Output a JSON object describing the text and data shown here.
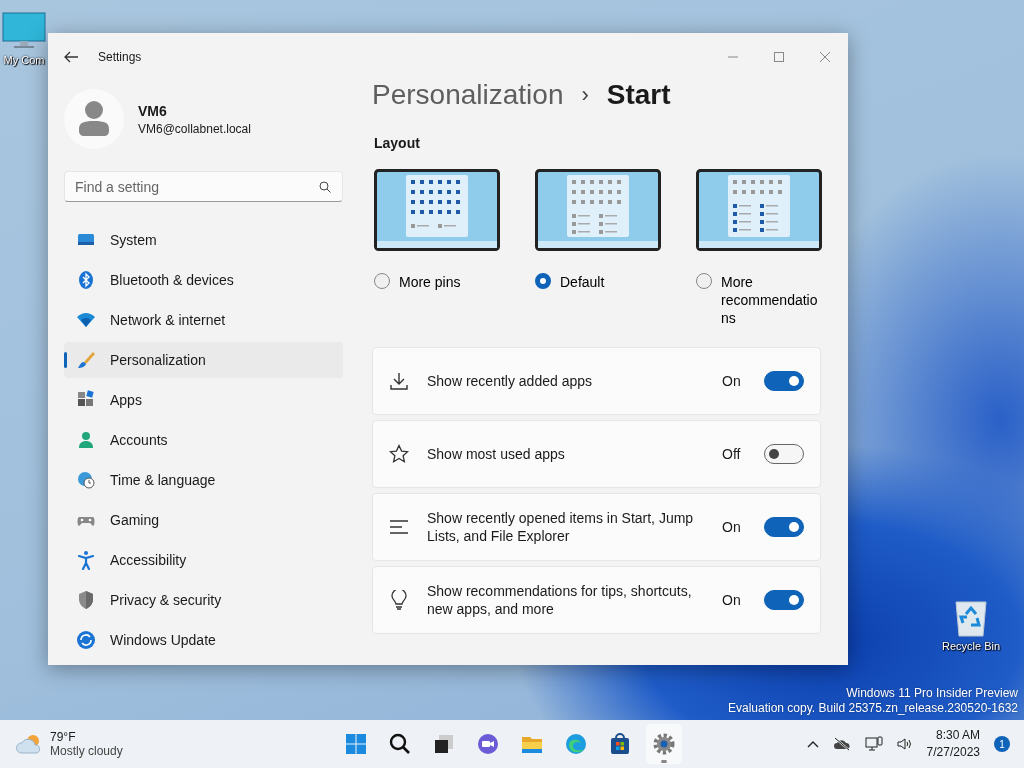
{
  "desktop": {
    "icons": [
      {
        "kind": "computer",
        "label": "My Com"
      },
      {
        "kind": "recycle",
        "label": "Recycle Bin"
      }
    ],
    "watermark": [
      "Windows 11 Pro Insider Preview",
      "Evaluation copy. Build 25375.zn_release.230520-1632"
    ]
  },
  "window": {
    "title": "Settings",
    "profile": {
      "name": "VM6",
      "email": "VM6@collabnet.local"
    },
    "search": {
      "placeholder": "Find a setting"
    },
    "nav": [
      {
        "kind": "system",
        "label": "System",
        "selected": false
      },
      {
        "kind": "bluetooth",
        "label": "Bluetooth & devices",
        "selected": false
      },
      {
        "kind": "network",
        "label": "Network & internet",
        "selected": false
      },
      {
        "kind": "personalization",
        "label": "Personalization",
        "selected": true
      },
      {
        "kind": "apps",
        "label": "Apps",
        "selected": false
      },
      {
        "kind": "accounts",
        "label": "Accounts",
        "selected": false
      },
      {
        "kind": "time",
        "label": "Time & language",
        "selected": false
      },
      {
        "kind": "gaming",
        "label": "Gaming",
        "selected": false
      },
      {
        "kind": "accessibility",
        "label": "Accessibility",
        "selected": false
      },
      {
        "kind": "privacy",
        "label": "Privacy & security",
        "selected": false
      },
      {
        "kind": "update",
        "label": "Windows Update",
        "selected": false
      }
    ],
    "breadcrumb": {
      "parent": "Personalization",
      "separator": "›",
      "current": "Start"
    },
    "layout": {
      "heading": "Layout",
      "options": [
        {
          "kind": "more_pins",
          "label": "More pins",
          "selected": false
        },
        {
          "kind": "default",
          "label": "Default",
          "selected": true
        },
        {
          "kind": "more_recommendations",
          "label": "More recommendations",
          "selected": false
        }
      ]
    },
    "settings": [
      {
        "kind": "download",
        "label": "Show recently added apps",
        "state": "On",
        "on": true
      },
      {
        "kind": "star",
        "label": "Show most used apps",
        "state": "Off",
        "on": false
      },
      {
        "kind": "list",
        "label": "Show recently opened items in Start, Jump Lists, and File Explorer",
        "state": "On",
        "on": true
      },
      {
        "kind": "bulb",
        "label": "Show recommendations for tips, shortcuts, new apps, and more",
        "state": "On",
        "on": true
      }
    ]
  },
  "taskbar": {
    "weather": {
      "temperature": "79°F",
      "condition": "Mostly cloudy"
    },
    "apps": [
      {
        "kind": "start",
        "active": false
      },
      {
        "kind": "search",
        "active": false
      },
      {
        "kind": "taskview",
        "active": false
      },
      {
        "kind": "chat",
        "active": false
      },
      {
        "kind": "explorer",
        "active": false
      },
      {
        "kind": "edge",
        "active": false
      },
      {
        "kind": "store",
        "active": false
      },
      {
        "kind": "settings",
        "active": true
      }
    ],
    "time": "8:30 AM",
    "date": "7/27/2023",
    "notifications": "1"
  }
}
